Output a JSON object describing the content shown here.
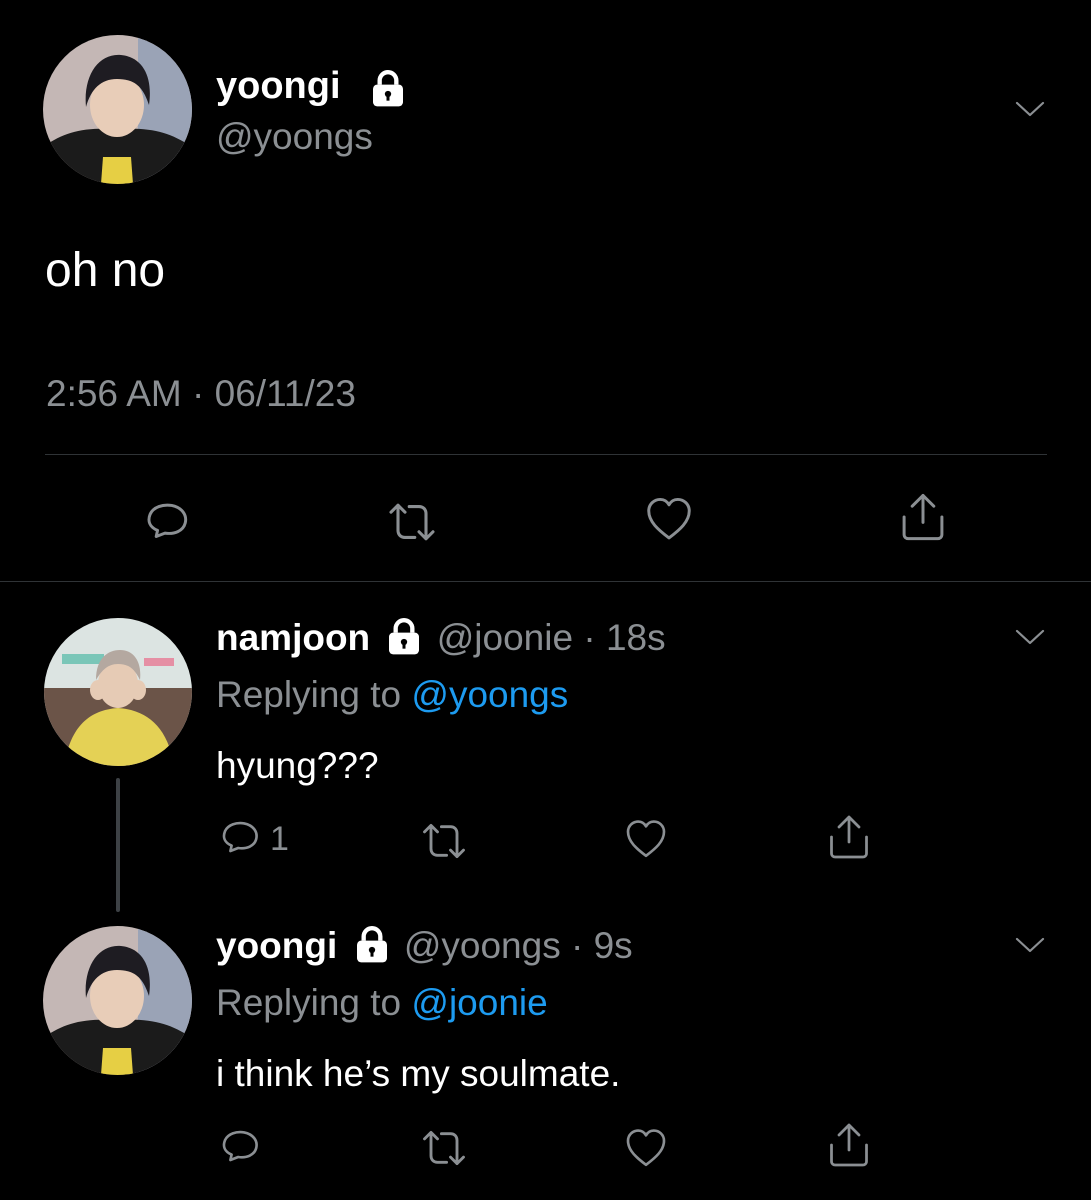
{
  "main_tweet": {
    "display_name": "yoongi",
    "handle": "@yoongs",
    "text": "oh no",
    "time": "2:56 AM",
    "separator": "·",
    "date": "06/11/23"
  },
  "replies": [
    {
      "display_name": "namjoon",
      "handle": "@joonie",
      "separator": "·",
      "age": "18s",
      "replying_prefix": "Replying to",
      "replying_to": "@yoongs",
      "text": "hyung???",
      "reply_count": "1"
    },
    {
      "display_name": "yoongi",
      "handle": "@yoongs",
      "separator": "·",
      "age": "9s",
      "replying_prefix": "Replying to",
      "replying_to": "@joonie",
      "text": "i think he’s my soulmate."
    }
  ],
  "icons": [
    "lock-icon",
    "chevron-down-icon",
    "reply-icon",
    "retweet-icon",
    "like-icon",
    "share-icon"
  ],
  "colors": {
    "background": "#000000",
    "text": "#ffffff",
    "secondary": "#8b8f93",
    "link": "#1d9bf0",
    "divider": "#2f3336"
  }
}
